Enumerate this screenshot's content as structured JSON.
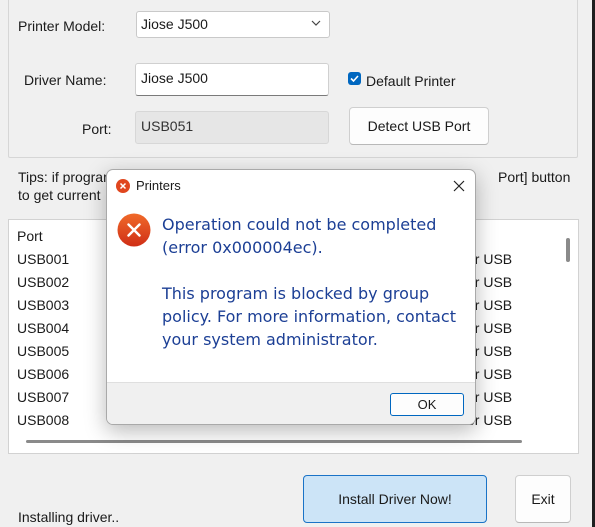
{
  "settings": {
    "printer_model_label": "Printer Model:",
    "printer_model_value": "Jiose J500",
    "driver_name_label": "Driver Name:",
    "driver_name_value": "Jiose J500",
    "default_printer_label": "Default Printer",
    "default_printer_checked": true,
    "port_label": "Port:",
    "port_value": "USB051",
    "detect_button": "Detect USB Port"
  },
  "tips": {
    "line1_left": "Tips: if program",
    "line1_right": "Port] button",
    "line2_left": "to get current"
  },
  "port_list": {
    "header": "Port",
    "rows": [
      "USB001",
      "USB002",
      "USB003",
      "USB004",
      "USB005",
      "USB006",
      "USB007",
      "USB008"
    ],
    "right_column": [
      "or USB",
      "or USB",
      "or USB",
      "or USB",
      "or USB",
      "or USB",
      "or USB",
      "or USB"
    ]
  },
  "actions": {
    "install_button": "Install Driver Now!",
    "exit_button": "Exit"
  },
  "status": "Installing driver..",
  "dialog": {
    "title": "Printers",
    "message_line1": "Operation could not be completed",
    "message_line2": "(error 0x000004ec).",
    "message_line3": "This program is blocked by group",
    "message_line4": "policy. For more information, contact",
    "message_line5": "your system administrator.",
    "ok_button": "OK"
  },
  "colors": {
    "accent": "#0067c0",
    "error_red": "#c42b1c",
    "message_text": "#1c3f95",
    "install_button_bg": "#cce4f7"
  },
  "icons": [
    "chevron-down-icon",
    "checkmark-icon",
    "error-icon",
    "close-icon"
  ]
}
